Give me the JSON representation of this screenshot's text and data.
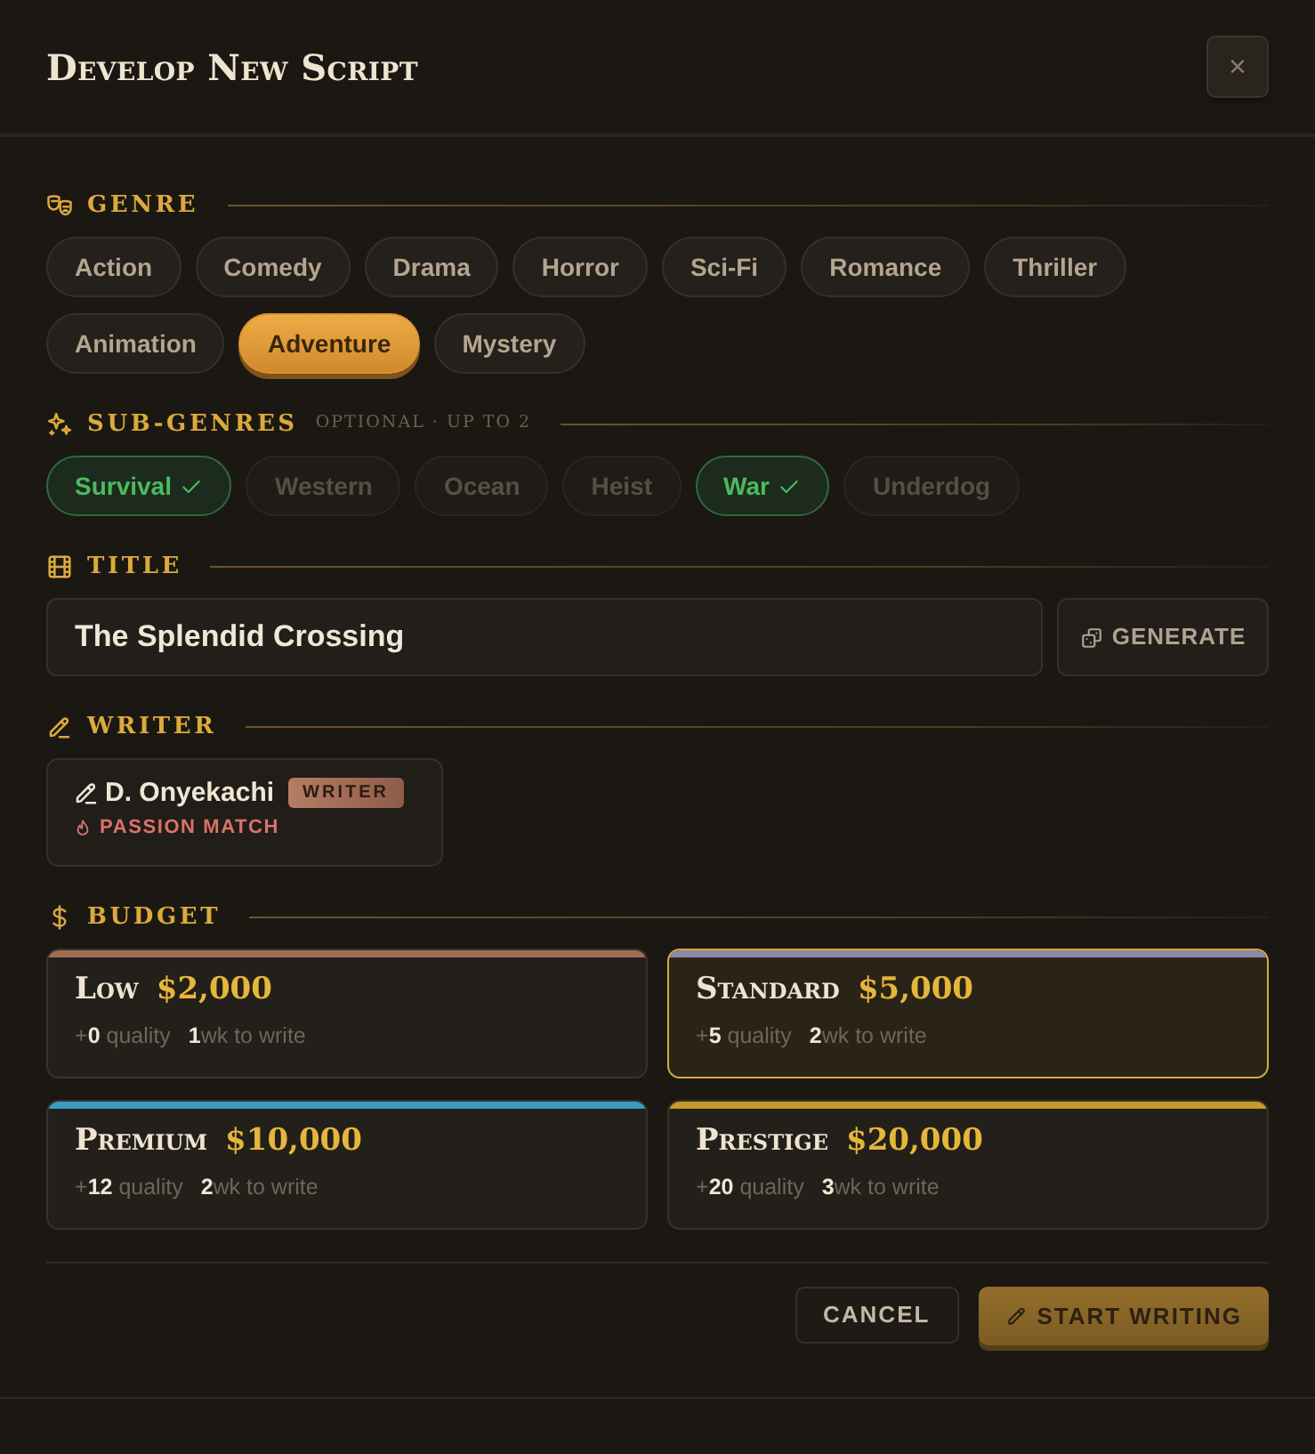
{
  "dialog": {
    "title": "Develop New Script",
    "close": "×"
  },
  "genre": {
    "label": "GENRE",
    "options": [
      {
        "label": "Action",
        "selected": false
      },
      {
        "label": "Comedy",
        "selected": false
      },
      {
        "label": "Drama",
        "selected": false
      },
      {
        "label": "Horror",
        "selected": false
      },
      {
        "label": "Sci-Fi",
        "selected": false
      },
      {
        "label": "Romance",
        "selected": false
      },
      {
        "label": "Thriller",
        "selected": false
      },
      {
        "label": "Animation",
        "selected": false
      },
      {
        "label": "Adventure",
        "selected": true
      },
      {
        "label": "Mystery",
        "selected": false
      }
    ]
  },
  "subgenres": {
    "label": "SUB-GENRES",
    "hint": "OPTIONAL · UP TO 2",
    "options": [
      {
        "label": "Survival",
        "selected": true
      },
      {
        "label": "Western",
        "selected": false
      },
      {
        "label": "Ocean",
        "selected": false
      },
      {
        "label": "Heist",
        "selected": false
      },
      {
        "label": "War",
        "selected": true
      },
      {
        "label": "Underdog",
        "selected": false
      }
    ]
  },
  "title_field": {
    "label": "TITLE",
    "value": "The Splendid Crossing",
    "generate": "GENERATE"
  },
  "writer": {
    "label": "WRITER",
    "name": "D. Onyekachi",
    "badge": "WRITER",
    "trait": "PASSION MATCH"
  },
  "budget": {
    "label": "BUDGET",
    "tiers": [
      {
        "name": "Low",
        "price": "$2,000",
        "quality": "+**0** quality",
        "time": "**1**wk to write",
        "color": "#a06d55",
        "selected": false
      },
      {
        "name": "Standard",
        "price": "$5,000",
        "quality": "+**5** quality",
        "time": "**2**wk to write",
        "color": "#8e8aa6",
        "selected": true
      },
      {
        "name": "Premium",
        "price": "$10,000",
        "quality": "+**12** quality",
        "time": "**2**wk to write",
        "color": "#3a9cc2",
        "selected": false
      },
      {
        "name": "Prestige",
        "price": "$20,000",
        "quality": "+**20** quality",
        "time": "**3**wk to write",
        "color": "#c49a2e",
        "selected": false
      }
    ]
  },
  "footer": {
    "cancel": "CANCEL",
    "confirm": "START WRITING"
  }
}
